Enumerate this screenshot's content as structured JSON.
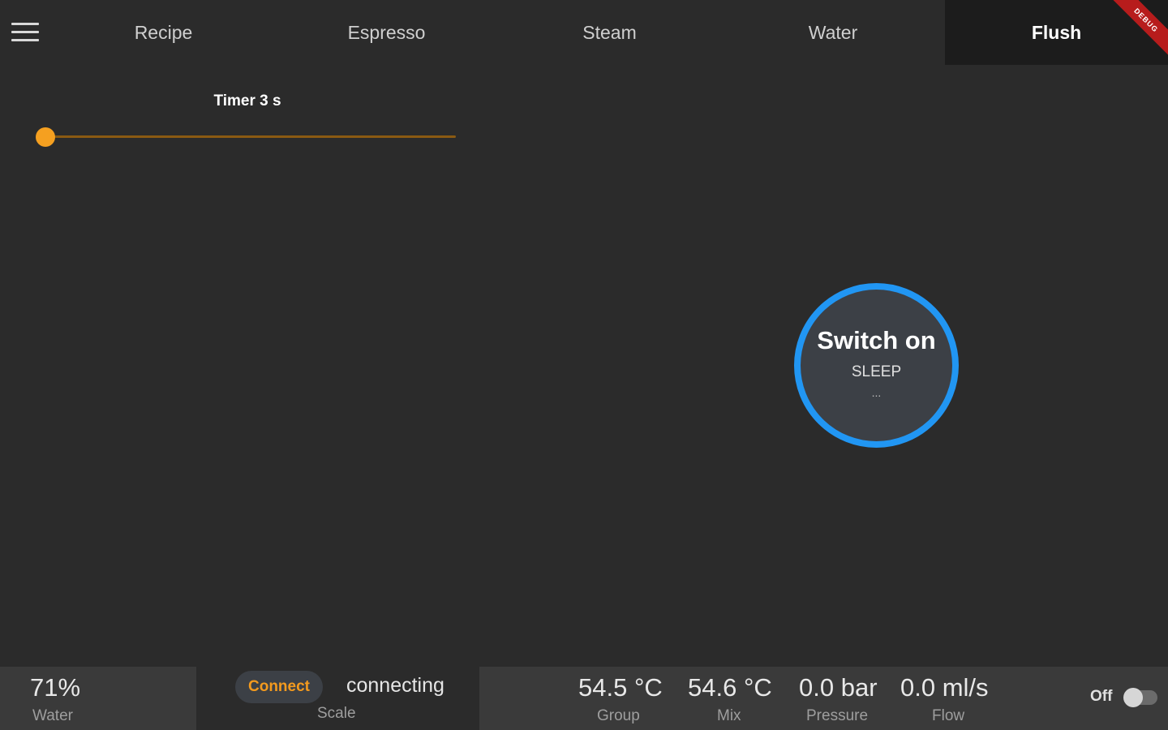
{
  "tabs": [
    {
      "label": "Recipe"
    },
    {
      "label": "Espresso"
    },
    {
      "label": "Steam"
    },
    {
      "label": "Water"
    },
    {
      "label": "Flush"
    }
  ],
  "active_tab": "Flush",
  "debug_banner": "DEBUG",
  "timer": {
    "label": "Timer 3 s",
    "value_fraction": 0.0
  },
  "power": {
    "title": "Switch on",
    "state": "SLEEP",
    "substate": "..."
  },
  "status": {
    "water": {
      "value": "71%",
      "label": "Water"
    },
    "scale": {
      "button": "Connect",
      "status": "connecting",
      "label": "Scale"
    },
    "group": {
      "value": "54.5 °C",
      "label": "Group"
    },
    "mix": {
      "value": "54.6 °C",
      "label": "Mix"
    },
    "pressure": {
      "value": "0.0 bar",
      "label": "Pressure"
    },
    "flow": {
      "value": "0.0 ml/s",
      "label": "Flow"
    },
    "toggle": {
      "label": "Off",
      "on": false
    }
  },
  "colors": {
    "background": "#2b2b2b",
    "accent": "#f39a1e",
    "power_ring": "#2196f3"
  }
}
